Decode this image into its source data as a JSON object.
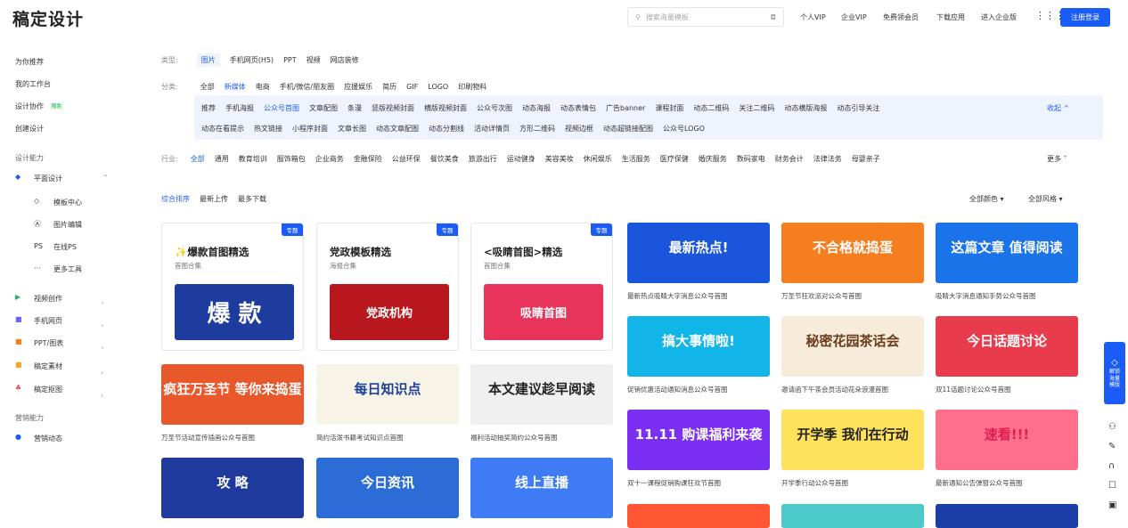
{
  "header": {
    "logo": "稿定设计",
    "search_placeholder": "搜索海量模板",
    "nav": [
      "个人VIP",
      "企业VIP",
      "免费领会员",
      "下载应用",
      "进入企业版"
    ],
    "register": "注册登录"
  },
  "sidebar": {
    "items": [
      "为你推荐",
      "我的工作台",
      "设计协作",
      "创建设计"
    ],
    "badge": "限免",
    "section1": "设计能力",
    "flat": "平面设计",
    "sub": [
      "模板中心",
      "图片编辑",
      "在线PS",
      "更多工具"
    ],
    "sub_icons": [
      "◇",
      "Ⓐ",
      "PS",
      "···"
    ],
    "more": [
      "视频创作",
      "手机网页",
      "PPT/图表",
      "稿定素材",
      "稿定抠图"
    ],
    "section2": "营销能力",
    "marketing": "营销动态"
  },
  "filters": {
    "type_label": "类型:",
    "types": [
      "图片",
      "手机网页(H5)",
      "PPT",
      "视频",
      "网店装修"
    ],
    "cat_label": "分类:",
    "cats": [
      "全部",
      "新媒体",
      "电商",
      "手机/微信/朋友圈",
      "应援娱乐",
      "简历",
      "GIF",
      "LOGO",
      "印刷物料"
    ],
    "sub1": [
      "推荐",
      "手机海报",
      "公众号首图",
      "文章配图",
      "条漫",
      "竖版视频封面",
      "横版视频封面",
      "公众号次图",
      "动态海报",
      "动态表情包",
      "广告banner",
      "课程封面",
      "动态二维码",
      "关注二维码",
      "动态横版海报",
      "动态引导关注"
    ],
    "sub2": [
      "动态在看提示",
      "热文链接",
      "小程序封面",
      "文章长图",
      "动态文章配图",
      "动态分割线",
      "活动详情页",
      "方形二维码",
      "视频边框",
      "动态超链接配图",
      "公众号LOGO"
    ],
    "collapse": "收起 ^",
    "ind_label": "行业:",
    "inds": [
      "全部",
      "通用",
      "教育培训",
      "服饰箱包",
      "企业商务",
      "金融保险",
      "公益环保",
      "餐饮美食",
      "旅游出行",
      "运动健身",
      "美容美妆",
      "休闲娱乐",
      "生活服务",
      "医疗保健",
      "婚庆服务",
      "数码家电",
      "财务会计",
      "法律法务",
      "母婴亲子"
    ],
    "more": "更多 ˅"
  },
  "sort": {
    "options": [
      "综合排序",
      "最新上传",
      "最多下载"
    ],
    "color": "全部颜色 ▾",
    "style": "全部风格 ▾"
  },
  "feature": [
    {
      "tag": "专题",
      "title": "✨爆款首图精选",
      "sub": "首图合集",
      "img": "爆 款"
    },
    {
      "tag": "专题",
      "title": "党政模板精选",
      "sub": "海报合集",
      "img": "党政机构"
    },
    {
      "tag": "专题",
      "title": "<吸睛首图>精选",
      "sub": "首图合集",
      "img": "吸睛首图"
    }
  ],
  "cards": [
    {
      "text": "最新热点!",
      "cap": "最新热点吸睛大字消息公众号首图"
    },
    {
      "text": "不合格就捣蛋",
      "cap": "万圣节狂欢派对公众号首图"
    },
    {
      "text": "这篇文章 值得阅读",
      "cap": "吸睛大字消息通知手势公众号首图"
    },
    {
      "text": "疯狂万圣节 等你来捣蛋",
      "cap": "万圣节活动宣传插画公众号首图"
    },
    {
      "text": "每日知识点",
      "cap": "简约活泼书籍考试知识点首图"
    },
    {
      "text": "本文建议趁早阅读",
      "cap": "福利活动抽奖简约公众号首图"
    },
    {
      "text": "搞大事情啦!",
      "cap": "促销优惠活动通知消息公众号首图"
    },
    {
      "text": "秘密花园茶话会",
      "cap": "邀请函下午茶会员活动花朵浪漫首图"
    },
    {
      "text": "今日话题讨论",
      "cap": "双11话题讨论公众号首图"
    },
    {
      "text": "11.11 购课福利来袭",
      "cap": "双十一课程促销购课狂欢节首图"
    },
    {
      "text": "开学季 我们在行动",
      "cap": "开学季行动公众号首图"
    },
    {
      "text": "速看!!!",
      "cap": "最新通知公告弹窗公众号首图"
    },
    {
      "text": "攻 略",
      "cap": ""
    },
    {
      "text": "今日资讯",
      "cap": ""
    },
    {
      "text": "线上直播",
      "cap": ""
    },
    {
      "text": "",
      "cap": ""
    },
    {
      "text": "",
      "cap": ""
    },
    {
      "text": "",
      "cap": ""
    }
  ],
  "rightbar": {
    "vip": "解锁 海量 模版"
  }
}
